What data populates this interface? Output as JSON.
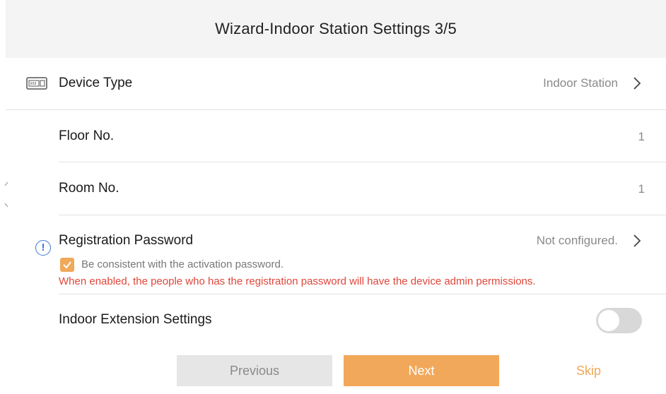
{
  "header": {
    "title": "Wizard-Indoor Station Settings 3/5"
  },
  "rows": {
    "device_type": {
      "label": "Device Type",
      "value": "Indoor Station",
      "icon": "device-icon"
    },
    "floor_no": {
      "label": "Floor No.",
      "value": "1"
    },
    "room_no": {
      "label": "Room No.",
      "value": "1"
    },
    "registration_password": {
      "label": "Registration Password",
      "value": "Not configured.",
      "checkbox_label": "Be consistent with the activation password.",
      "checkbox_checked": true,
      "warning": "When enabled, the people who has the registration password will have the device admin permissions."
    },
    "indoor_extension": {
      "label": "Indoor Extension Settings",
      "toggle_on": false
    }
  },
  "footer": {
    "previous_label": "Previous",
    "next_label": "Next",
    "skip_label": "Skip"
  },
  "colors": {
    "accent": "#f2a85a",
    "warning": "#e0463a",
    "info": "#3a78d8",
    "toggle_off": "#d8d8d8"
  }
}
